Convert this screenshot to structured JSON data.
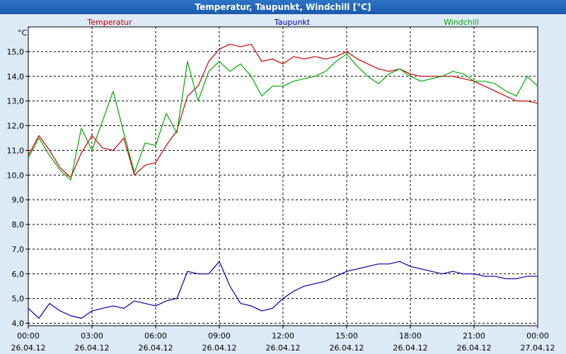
{
  "window": {
    "title": "Temperatur, Taupunkt, Windchill [°C]"
  },
  "colors": {
    "temperatur": "#cc0000",
    "taupunkt": "#0000aa",
    "windchill": "#00aa00",
    "grid": "#000000"
  },
  "chart_data": {
    "type": "line",
    "title": "Temperatur, Taupunkt, Windchill [°C]",
    "ylabel": "°C",
    "ylim": [
      3.9,
      16.0
    ],
    "yticks": [
      "4,0",
      "5,0",
      "6,0",
      "7,0",
      "8,0",
      "9,0",
      "10,0",
      "11,0",
      "12,0",
      "13,0",
      "14,0",
      "15,0"
    ],
    "xlim": [
      0,
      24
    ],
    "xticks": [
      {
        "time": "00:00",
        "date": "26.04.12"
      },
      {
        "time": "03:00",
        "date": "26.04.12"
      },
      {
        "time": "06:00",
        "date": "26.04.12"
      },
      {
        "time": "09:00",
        "date": "26.04.12"
      },
      {
        "time": "12:00",
        "date": "26.04.12"
      },
      {
        "time": "15:00",
        "date": "26.04.12"
      },
      {
        "time": "18:00",
        "date": "26.04.12"
      },
      {
        "time": "21:00",
        "date": "26.04.12"
      },
      {
        "time": "00:00",
        "date": "27.04.12"
      }
    ],
    "grid": true,
    "legend_placement": "top",
    "series": [
      {
        "name": "Temperatur",
        "x": [
          0,
          0.5,
          1,
          1.5,
          2,
          2.5,
          3,
          3.5,
          4,
          4.5,
          5,
          5.5,
          6,
          6.5,
          7,
          7.5,
          8,
          8.5,
          9,
          9.5,
          10,
          10.5,
          11,
          11.5,
          12,
          12.5,
          13,
          13.5,
          14,
          14.5,
          15,
          15.5,
          16,
          16.5,
          17,
          17.5,
          18,
          18.5,
          19,
          19.5,
          20,
          20.5,
          21,
          21.5,
          22,
          22.5,
          23,
          23.5,
          24
        ],
        "values": [
          10.8,
          11.6,
          11.0,
          10.3,
          9.9,
          10.9,
          11.6,
          11.1,
          11.0,
          11.5,
          10.0,
          10.4,
          10.5,
          11.2,
          11.8,
          13.2,
          13.6,
          14.6,
          15.1,
          15.3,
          15.2,
          15.3,
          14.6,
          14.7,
          14.5,
          14.8,
          14.7,
          14.8,
          14.7,
          14.8,
          15.0,
          14.7,
          14.5,
          14.3,
          14.2,
          14.3,
          14.1,
          14.0,
          14.0,
          14.0,
          14.0,
          13.9,
          13.8,
          13.6,
          13.4,
          13.2,
          13.0,
          13.0,
          12.9
        ]
      },
      {
        "name": "Taupunkt",
        "x": [
          0,
          0.5,
          1,
          1.5,
          2,
          2.5,
          3,
          3.5,
          4,
          4.5,
          5,
          5.5,
          6,
          6.5,
          7,
          7.5,
          8,
          8.5,
          9,
          9.5,
          10,
          10.5,
          11,
          11.5,
          12,
          12.5,
          13,
          13.5,
          14,
          14.5,
          15,
          15.5,
          16,
          16.5,
          17,
          17.5,
          18,
          18.5,
          19,
          19.5,
          20,
          20.5,
          21,
          21.5,
          22,
          22.5,
          23,
          23.5,
          24
        ],
        "values": [
          4.6,
          4.2,
          4.8,
          4.5,
          4.3,
          4.2,
          4.5,
          4.6,
          4.7,
          4.6,
          4.9,
          4.8,
          4.7,
          4.9,
          5.0,
          6.1,
          6.0,
          6.0,
          6.5,
          5.5,
          4.8,
          4.7,
          4.5,
          4.6,
          5.0,
          5.3,
          5.5,
          5.6,
          5.7,
          5.9,
          6.1,
          6.2,
          6.3,
          6.4,
          6.4,
          6.5,
          6.3,
          6.2,
          6.1,
          6.0,
          6.1,
          6.0,
          6.0,
          5.9,
          5.9,
          5.8,
          5.8,
          5.9,
          5.9
        ]
      },
      {
        "name": "Windchill",
        "x": [
          0,
          0.5,
          1,
          1.5,
          2,
          2.5,
          3,
          3.5,
          4,
          4.5,
          5,
          5.5,
          6,
          6.5,
          7,
          7.5,
          8,
          8.5,
          9,
          9.5,
          10,
          10.5,
          11,
          11.5,
          12,
          12.5,
          13,
          13.5,
          14,
          14.5,
          15,
          15.5,
          16,
          16.5,
          17,
          17.5,
          18,
          18.5,
          19,
          19.5,
          20,
          20.5,
          21,
          21.5,
          22,
          22.5,
          23,
          23.5,
          24
        ],
        "values": [
          10.7,
          11.5,
          10.8,
          10.2,
          9.8,
          11.9,
          11.0,
          12.2,
          13.4,
          11.7,
          10.1,
          11.3,
          11.2,
          12.5,
          11.7,
          14.6,
          13.0,
          14.2,
          14.6,
          14.2,
          14.5,
          14.0,
          13.2,
          13.6,
          13.6,
          13.8,
          13.9,
          14.0,
          14.2,
          14.6,
          14.9,
          14.4,
          14.0,
          13.7,
          14.1,
          14.3,
          14.0,
          13.8,
          13.9,
          14.0,
          14.2,
          14.1,
          13.8,
          13.8,
          13.7,
          13.4,
          13.2,
          14.0,
          13.6
        ]
      }
    ]
  }
}
